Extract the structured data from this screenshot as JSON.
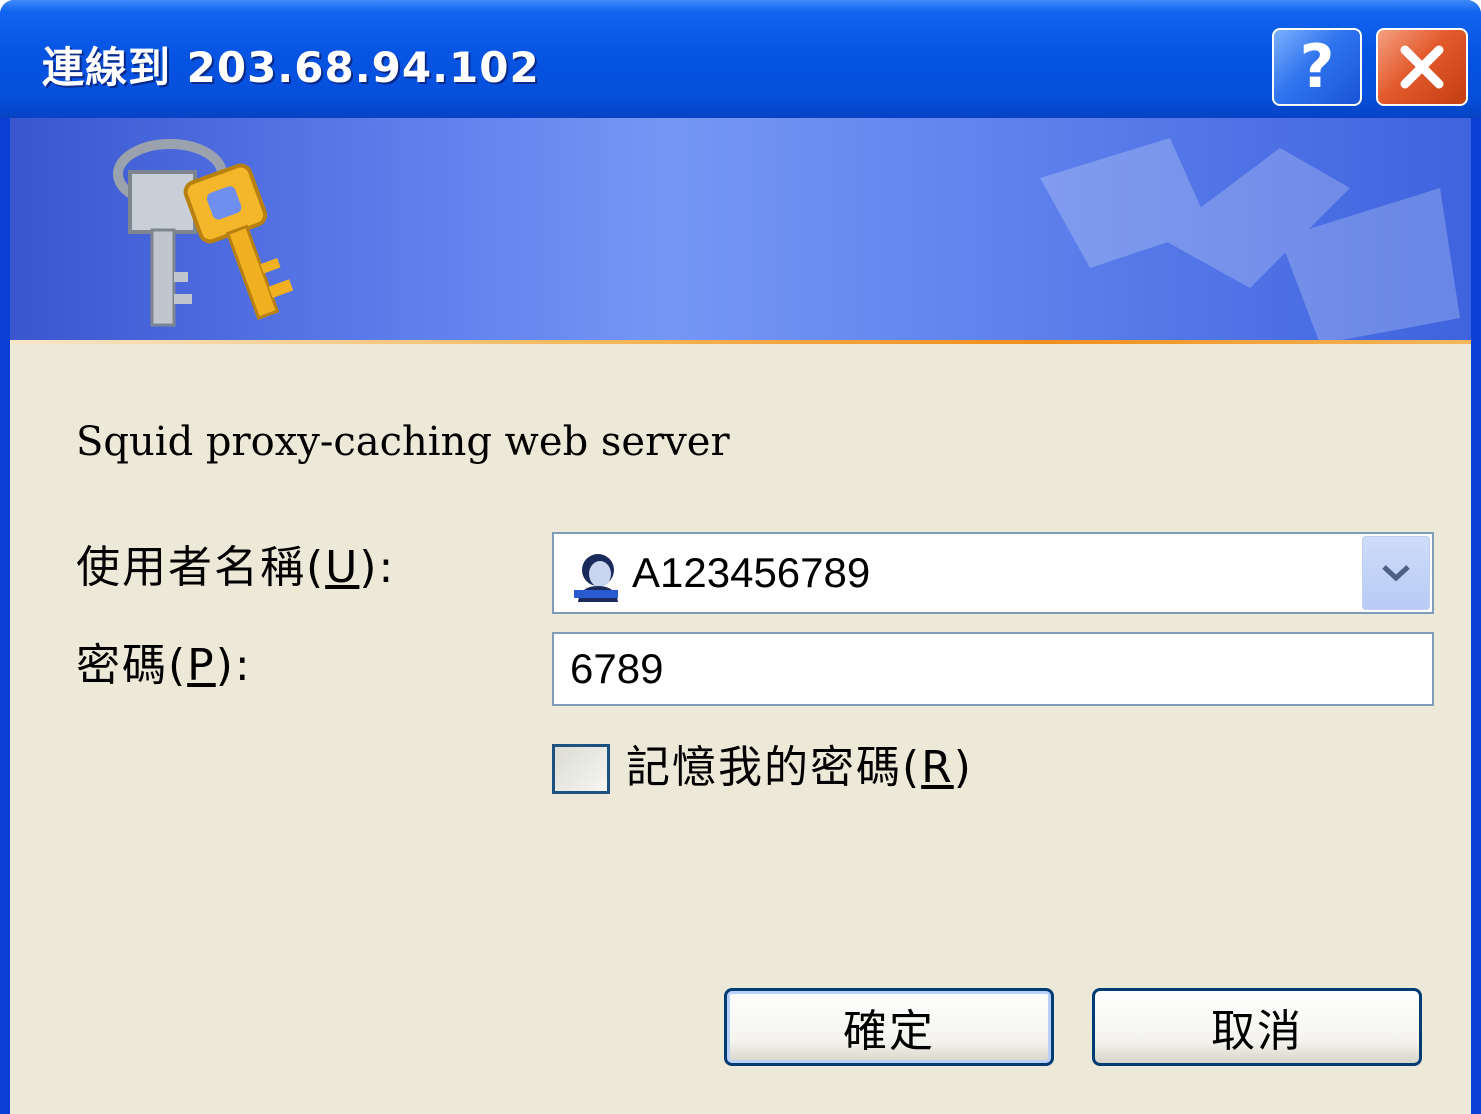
{
  "window": {
    "title": "連線到 203.68.94.102"
  },
  "titlebar": {
    "help_label": "?",
    "close_icon": "close-x-icon"
  },
  "banner": {
    "icon": "keys-icon"
  },
  "realm": {
    "text": "Squid proxy-caching web server"
  },
  "form": {
    "username": {
      "label": "使用者名稱",
      "accesskey": "U",
      "value": "A123456789",
      "icon": "user-avatar-icon"
    },
    "password": {
      "label": "密碼",
      "accesskey": "P",
      "value": "6789"
    },
    "remember": {
      "label": "記憶我的密碼",
      "accesskey": "R",
      "checked": false
    }
  },
  "buttons": {
    "ok": "確定",
    "cancel": "取消"
  },
  "colors": {
    "titlebar": "#0550dc",
    "client_bg": "#ece9d8",
    "accent_line": "#f08f1c",
    "close_red": "#e35a2c"
  }
}
